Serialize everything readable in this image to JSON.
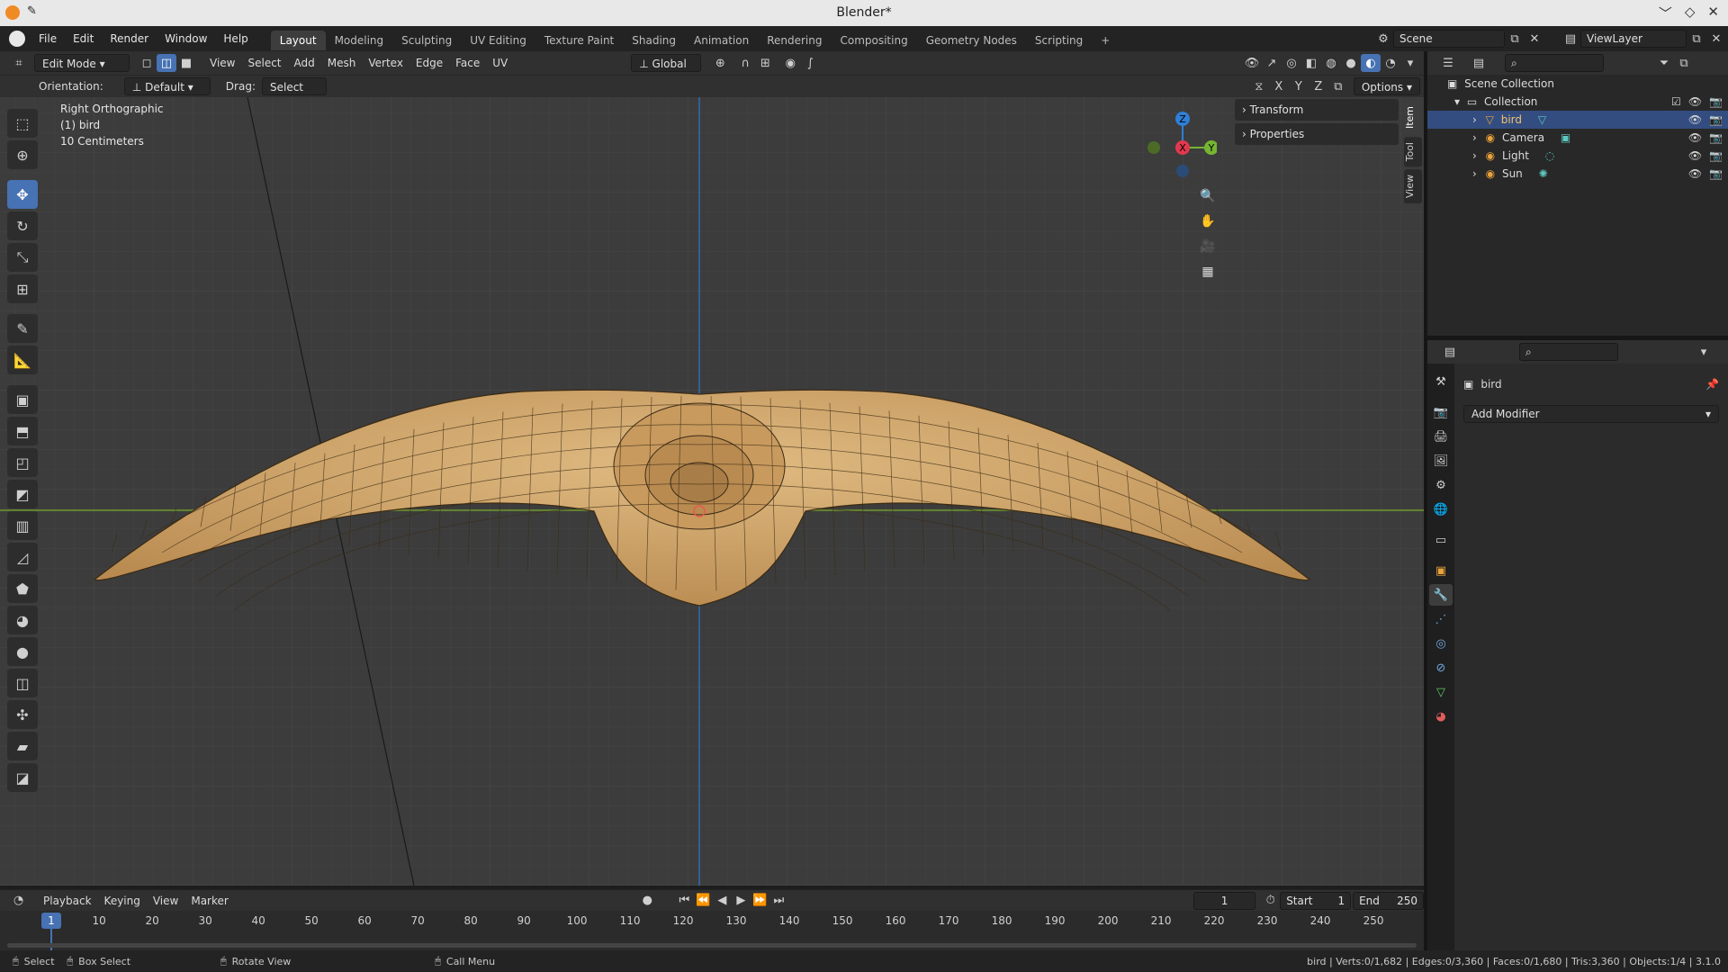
{
  "window": {
    "title": "Blender*"
  },
  "menubar": {
    "menus": [
      "File",
      "Edit",
      "Render",
      "Window",
      "Help"
    ],
    "workspaces": [
      "Layout",
      "Modeling",
      "Sculpting",
      "UV Editing",
      "Texture Paint",
      "Shading",
      "Animation",
      "Rendering",
      "Compositing",
      "Geometry Nodes",
      "Scripting",
      "+"
    ],
    "active_workspace": "Layout",
    "scene": "Scene",
    "view_layer": "ViewLayer"
  },
  "viewport_header": {
    "mode": "Edit Mode",
    "menus": [
      "View",
      "Select",
      "Add",
      "Mesh",
      "Vertex",
      "Edge",
      "Face",
      "UV"
    ],
    "transform_orientation": "Global"
  },
  "tool_header": {
    "orientation_label": "Orientation:",
    "orientation_value": "Default",
    "drag_label": "Drag:",
    "drag_value": "Select Box",
    "axes": [
      "X",
      "Y",
      "Z"
    ],
    "options": "Options"
  },
  "viewport_overlay": {
    "view_name": "Right Orthographic",
    "object": "(1) bird",
    "scale": "10 Centimeters"
  },
  "npanel": {
    "sections": [
      "Transform",
      "Properties"
    ],
    "tabs": [
      "Item",
      "Tool",
      "View"
    ],
    "active_tab": "Item"
  },
  "gizmo": {
    "axes": [
      "Z",
      "X",
      "Y"
    ]
  },
  "timeline_header": {
    "menus": [
      "Playback",
      "Keying",
      "View",
      "Marker"
    ],
    "current_frame": "1",
    "start_label": "Start",
    "start": "1",
    "end_label": "End",
    "end": "250"
  },
  "timeline": {
    "ticks": [
      "10",
      "20",
      "30",
      "40",
      "50",
      "60",
      "70",
      "80",
      "90",
      "100",
      "110",
      "120",
      "130",
      "140",
      "150",
      "160",
      "170",
      "180",
      "190",
      "200",
      "210",
      "220",
      "230",
      "240",
      "250"
    ],
    "current": "1"
  },
  "outliner": {
    "root": "Scene Collection",
    "collection": "Collection",
    "items": [
      {
        "name": "bird",
        "selected": true
      },
      {
        "name": "Camera",
        "selected": false
      },
      {
        "name": "Light",
        "selected": false
      },
      {
        "name": "Sun",
        "selected": false
      }
    ]
  },
  "properties": {
    "object_name": "bird",
    "add_modifier": "Add Modifier"
  },
  "statusbar": {
    "hints": [
      {
        "icon": "mouse-left-icon",
        "label": "Select"
      },
      {
        "icon": "mouse-left-drag-icon",
        "label": "Box Select"
      },
      {
        "icon": "mouse-middle-icon",
        "label": "Rotate View"
      },
      {
        "icon": "mouse-right-icon",
        "label": "Call Menu"
      }
    ],
    "stats": "bird | Verts:0/1,682 | Edges:0/3,360 | Faces:0/1,680 | Tris:3,360 | Objects:1/4 | 3.1.0"
  },
  "colors": {
    "accent": "#4772b3",
    "mesh": "#c9a26a",
    "x_axis": "#e2384f",
    "y_axis": "#76b533",
    "z_axis": "#2f7fd8"
  }
}
